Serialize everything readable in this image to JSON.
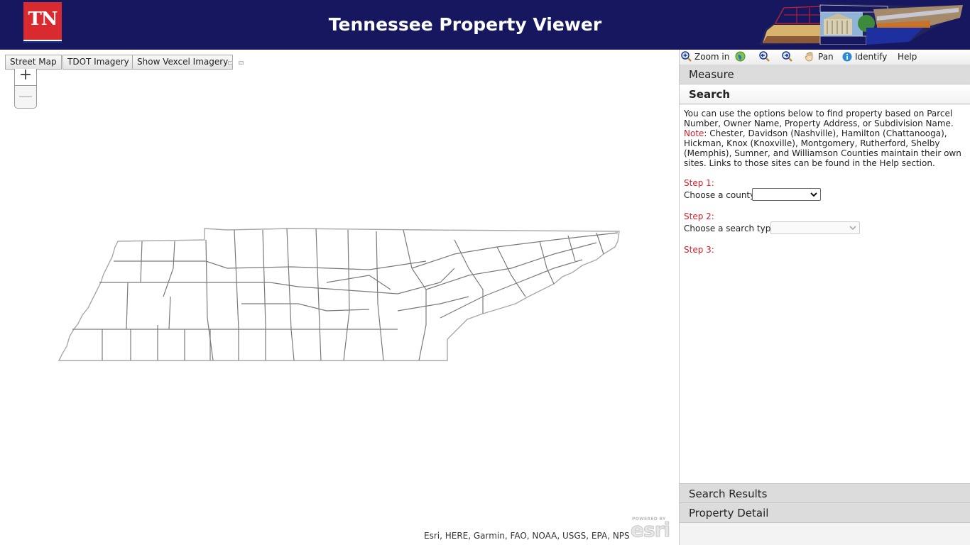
{
  "header": {
    "logo_text": "TN",
    "title": "Tennessee Property Viewer"
  },
  "map": {
    "basemap_buttons": [
      "Street Map",
      "TDOT Imagery",
      "Show Vexcel Imagery"
    ],
    "zoom_in_label": "+",
    "zoom_out_label": "—",
    "attribution": "Esri, HERE, Garmin, FAO, NOAA, USGS, EPA, NPS",
    "esri_powered_by": "POWERED BY",
    "esri_logo_text": "esri"
  },
  "toolbar": {
    "items": [
      {
        "label": "Zoom in",
        "icon": "zoom-in-icon"
      },
      {
        "label": "",
        "icon": "globe-icon"
      },
      {
        "label": "",
        "icon": "zoom-previous-icon"
      },
      {
        "label": "",
        "icon": "zoom-next-icon"
      },
      {
        "label": "Pan",
        "icon": "hand-icon"
      },
      {
        "label": "Identify",
        "icon": "info-icon"
      },
      {
        "label": "Help",
        "icon": ""
      }
    ]
  },
  "panel": {
    "measure_label": "Measure",
    "search_label": "Search",
    "search_results_label": "Search Results",
    "property_detail_label": "Property Detail",
    "intro_text": "You can use the options below to find property based on Parcel Number, Owner Name, Property Address, or Subdivision Name. ",
    "note_label": "Note",
    "note_text": ": Chester, Davidson (Nashville), Hamilton (Chattanooga), Hickman, Knox (Knoxville), Montgomery, Rutherford, Shelby (Memphis), Sumner, and Williamson Counties maintain their own sites. Links to those sites can be found in the Help section.",
    "step1_label": "Step 1:",
    "step1_field": "Choose a county:",
    "county_value": "",
    "step2_label": "Step 2:",
    "step2_field": "Choose a search type:",
    "search_type_value": "",
    "step3_label": "Step 3:"
  },
  "colors": {
    "header_bg": "#171760",
    "logo_red": "#d92b2f",
    "step_red": "#d0202a",
    "county_line": "#7a7a7a",
    "state_line": "#a9a9a9"
  }
}
